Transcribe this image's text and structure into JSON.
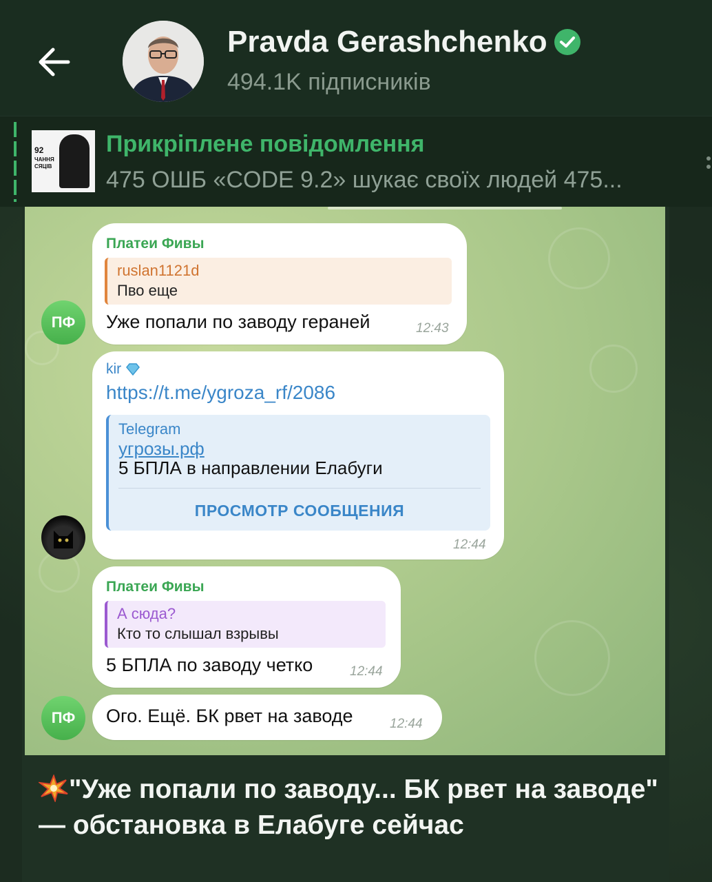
{
  "header": {
    "title": "Pravda Gerashchenko",
    "subscribers": "494.1K підписників",
    "verified": true
  },
  "pinned": {
    "label": "Прикріплене повідомлення",
    "text": "475 ОШБ «CODE 9.2» шукає своїх людей  475...",
    "thumb_lines": [
      "92",
      "ЧАННЯ",
      "СЯЦІВ"
    ]
  },
  "messages": [
    {
      "sender": "Платеи Фивы",
      "avatar": "ПФ",
      "reply_name": "ruslan1121d",
      "reply_text": "Пво еще",
      "text": "Уже попали по заводу гераней",
      "time": "12:43"
    },
    {
      "sender": "kir",
      "link": "https://t.me/ygroza_rf/2086",
      "preview_site": "Telegram",
      "preview_title": "угрозы.рф",
      "preview_text": "5 БПЛА в направлении Елабуги",
      "preview_button": "ПРОСМОТР СООБЩЕНИЯ",
      "time": "12:44"
    },
    {
      "sender": "Платеи Фивы",
      "reply_name": "А сюда?",
      "reply_text": "Кто то слышал взрывы",
      "text": "5 БПЛА по заводу четко",
      "time": "12:44"
    },
    {
      "avatar": "ПФ",
      "text": "Ого. Ещё. БК рвет на заводе",
      "time": "12:44"
    }
  ],
  "caption": "\"Уже попали по заводу... БК рвет на заводе\" — обстановка в Елабуге сейчас",
  "colors": {
    "accent": "#3fb56a",
    "header_bg": "#1a2d20",
    "chat_bg": "#a9c78a",
    "link": "#3a86c8"
  }
}
